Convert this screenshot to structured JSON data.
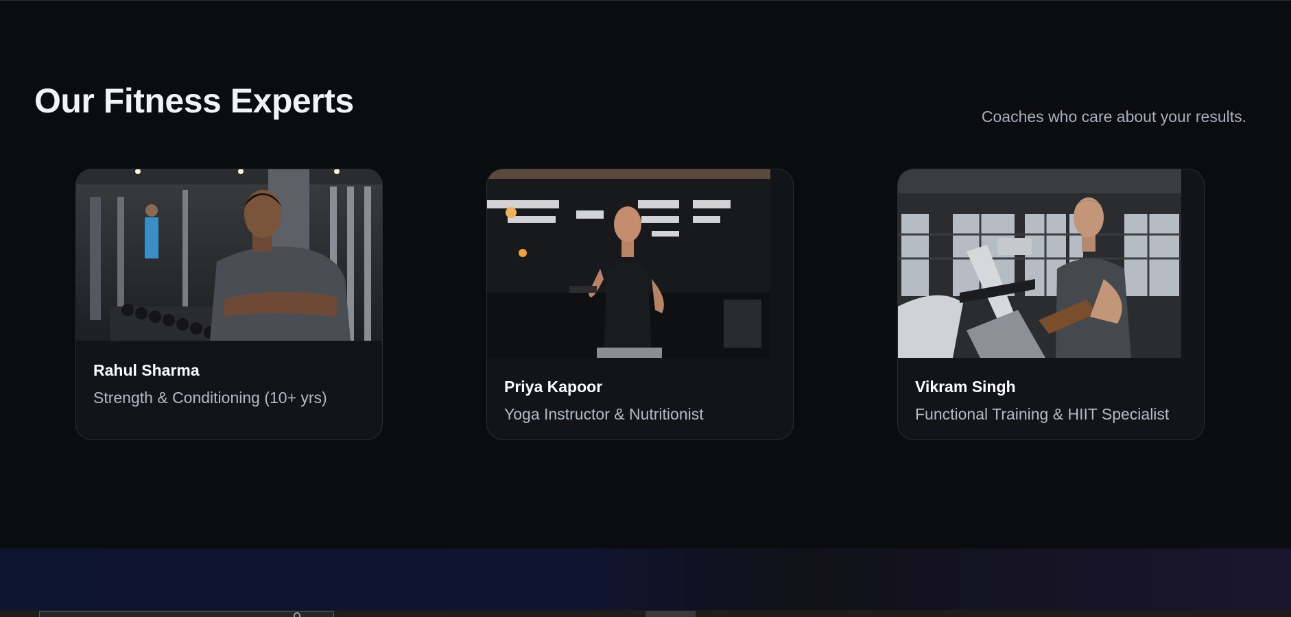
{
  "section": {
    "title": "Our Fitness Experts",
    "subtitle": "Coaches who care about your results."
  },
  "coaches": [
    {
      "name": "Rahul Sharma",
      "role": "Strength & Conditioning (10+ yrs)"
    },
    {
      "name": "Priya Kapoor",
      "role": "Yoga Instructor & Nutritionist"
    },
    {
      "name": "Vikram Singh",
      "role": "Functional Training & HIIT Specialist"
    }
  ],
  "colors": {
    "background": "#0b0c10",
    "card": "#121419",
    "card_border": "#2a2d35",
    "title": "#f1f3f7",
    "muted_text": "#b4bac5"
  }
}
